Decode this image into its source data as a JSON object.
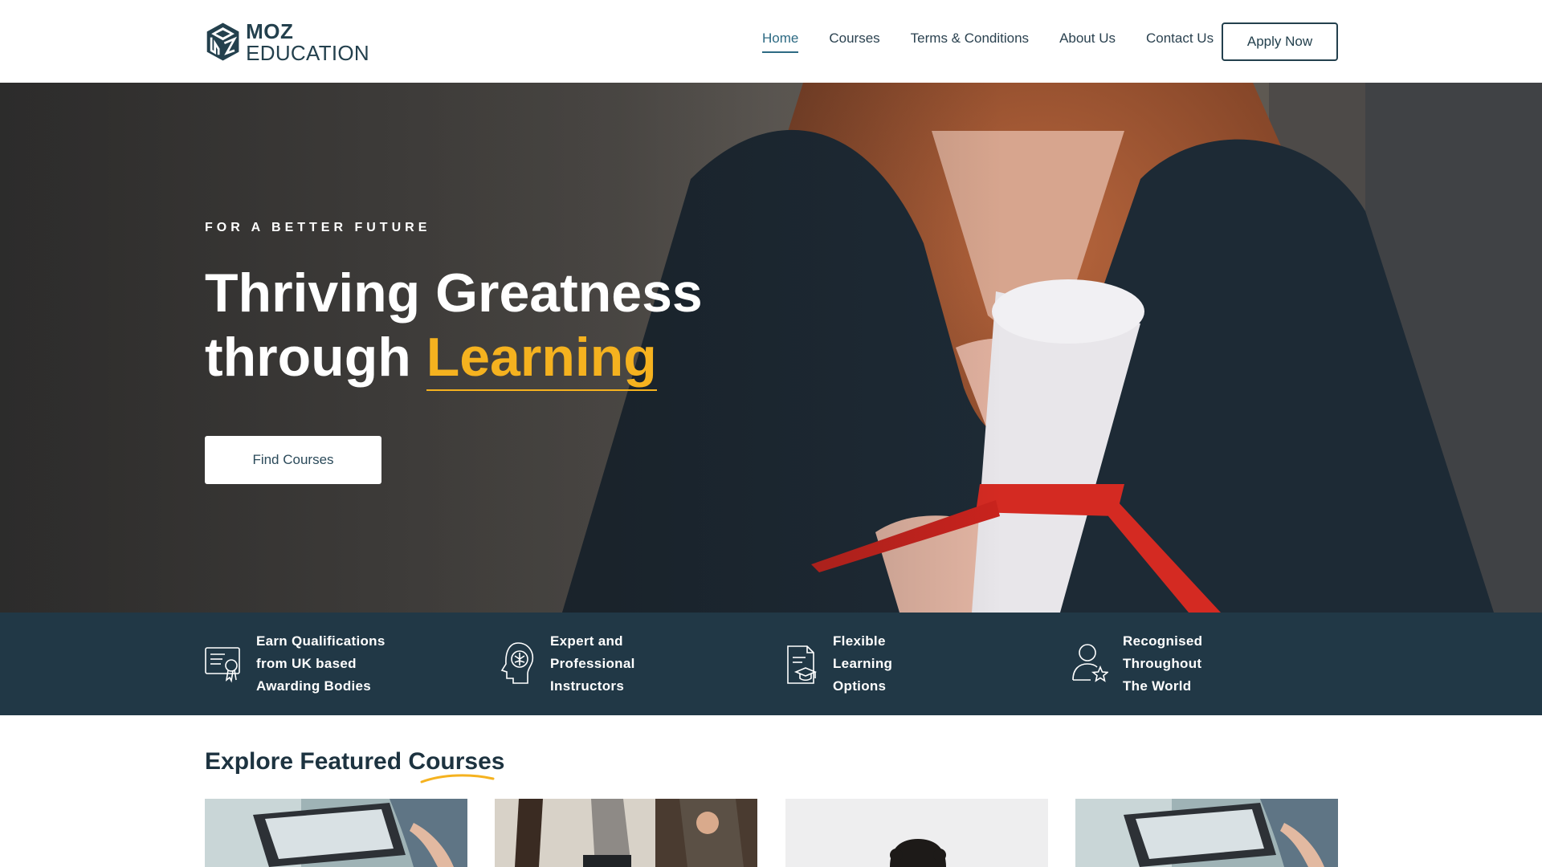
{
  "header": {
    "logo": {
      "line1": "MOZ",
      "line2": "EDUCATION"
    },
    "nav": [
      {
        "label": "Home",
        "active": true
      },
      {
        "label": "Courses",
        "active": false
      },
      {
        "label": "Terms & Conditions",
        "active": false
      },
      {
        "label": "About Us",
        "active": false
      },
      {
        "label": "Contact Us",
        "active": false
      }
    ],
    "apply_label": "Apply Now"
  },
  "hero": {
    "eyebrow": "FOR A BETTER FUTURE",
    "title_line1": "Thriving Greatness",
    "title_line2_prefix": "through ",
    "title_line2_accent": "Learning",
    "cta_label": "Find Courses"
  },
  "features": [
    {
      "icon": "certificate-icon",
      "lines": [
        "Earn Qualifications",
        "from UK based",
        "Awarding Bodies"
      ]
    },
    {
      "icon": "brain-head-icon",
      "lines": [
        "Expert and",
        "Professional",
        "Instructors"
      ]
    },
    {
      "icon": "graduation-document-icon",
      "lines": [
        "Flexible",
        "Learning",
        "Options"
      ]
    },
    {
      "icon": "user-star-icon",
      "lines": [
        "Recognised",
        "Throughout",
        "The World"
      ]
    }
  ],
  "featured": {
    "title": "Explore Featured Courses"
  },
  "colors": {
    "brand_dark": "#213846",
    "accent_yellow": "#f5b21f",
    "nav_active": "#2d6a83"
  }
}
